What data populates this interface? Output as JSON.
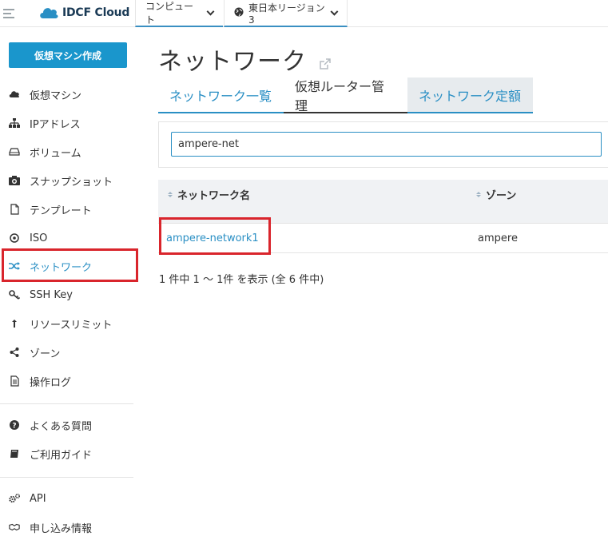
{
  "header": {
    "brand": "IDCF Cloud",
    "compute_label": "コンピュート",
    "region_label": "東日本リージョン3"
  },
  "sidebar": {
    "create_button": "仮想マシン作成",
    "items": [
      {
        "label": "仮想マシン",
        "icon": "cloud-icon"
      },
      {
        "label": "IPアドレス",
        "icon": "sitemap-icon"
      },
      {
        "label": "ボリューム",
        "icon": "hdd-icon"
      },
      {
        "label": "スナップショット",
        "icon": "camera-icon"
      },
      {
        "label": "テンプレート",
        "icon": "file-icon"
      },
      {
        "label": "ISO",
        "icon": "disc-icon"
      },
      {
        "label": "ネットワーク",
        "icon": "shuffle-icon"
      },
      {
        "label": "SSH Key",
        "icon": "key-icon"
      },
      {
        "label": "リソースリミット",
        "icon": "limit-icon"
      },
      {
        "label": "ゾーン",
        "icon": "share-icon"
      },
      {
        "label": "操作ログ",
        "icon": "log-icon"
      }
    ],
    "help_items": [
      {
        "label": "よくある質問",
        "icon": "question-icon"
      },
      {
        "label": "ご利用ガイド",
        "icon": "book-icon"
      }
    ],
    "extra_items": [
      {
        "label": "API",
        "icon": "gears-icon"
      },
      {
        "label": "申し込み情報",
        "icon": "handshake-icon"
      }
    ]
  },
  "main": {
    "title": "ネットワーク",
    "tabs": [
      "ネットワーク一覧",
      "仮想ルーター管理",
      "ネットワーク定額"
    ],
    "search_value": "ampere-net",
    "table": {
      "columns": [
        "ネットワーク名",
        "ゾーン"
      ],
      "rows": [
        {
          "name": "ampere-network1",
          "zone": "ampere"
        }
      ]
    },
    "pager_text": "1 件中 1 ～ 1件 を表示 (全 6 件中)"
  },
  "colors": {
    "accent": "#2a8fc4",
    "button": "#1a96cc",
    "highlight": "#d9252c"
  }
}
